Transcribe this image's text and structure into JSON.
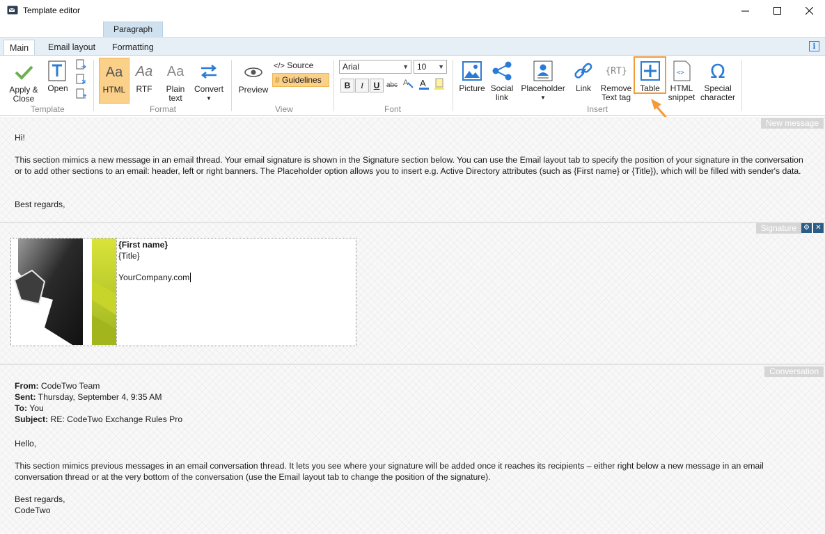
{
  "window": {
    "title": "Template editor"
  },
  "contextual_tab": "Paragraph",
  "tabs": [
    "Main",
    "Email layout",
    "Formatting"
  ],
  "ribbon": {
    "template": {
      "group": "Template",
      "apply_close": "Apply & Close",
      "open": "Open"
    },
    "format": {
      "group": "Format",
      "html": "HTML",
      "rtf": "RTF",
      "plain_text": "Plain text",
      "convert": "Convert",
      "aa": "Aa"
    },
    "view": {
      "group": "View",
      "preview": "Preview",
      "source": "Source",
      "guidelines": "Guidelines"
    },
    "font": {
      "group": "Font",
      "family": "Arial",
      "size": "10",
      "bold": "B",
      "italic": "I",
      "underline": "U",
      "strike": "abc"
    },
    "insert": {
      "group": "Insert",
      "picture": "Picture",
      "social_link": "Social link",
      "placeholder": "Placeholder",
      "link": "Link",
      "remove_text_tag": "Remove Text tag",
      "table": "Table",
      "html_snippet": "HTML snippet",
      "special_character": "Special character"
    }
  },
  "new_message": {
    "label": "New message",
    "greeting": "Hi!",
    "body": "This section mimics a new message in an email thread. Your email signature is shown in the Signature section below. You can use the Email layout tab to specify the position of your signature in the conversation or to add other sections to an email: header, left or right banners. The Placeholder option allows you to insert e.g. Active Directory attributes (such as {First name} or {Title}), which will be filled with sender's data.",
    "closing": "Best regards,"
  },
  "signature": {
    "label": "Signature",
    "first_name": "{First name}",
    "title": "{Title}",
    "website": "YourCompany.com"
  },
  "conversation": {
    "label": "Conversation",
    "from_label": "From:",
    "from": "CodeTwo Team",
    "sent_label": "Sent:",
    "sent": "Thursday, September 4, 9:35 AM",
    "to_label": "To:",
    "to": "You",
    "subject_label": "Subject:",
    "subject": "RE: CodeTwo Exchange Rules Pro",
    "greeting": "Hello,",
    "body": "This section mimics previous messages in an email conversation thread. It lets you see where your signature will be added once it reaches its recipients – either right below a new message in an email conversation thread or at the very bottom of the conversation (use the Email layout tab to change the position of the signature).",
    "closing": "Best regards,",
    "sender": "CodeTwo"
  },
  "colors": {
    "accent": "#2a7bd6",
    "highlight": "#f39a3a",
    "html_selected": "#fbd089"
  }
}
